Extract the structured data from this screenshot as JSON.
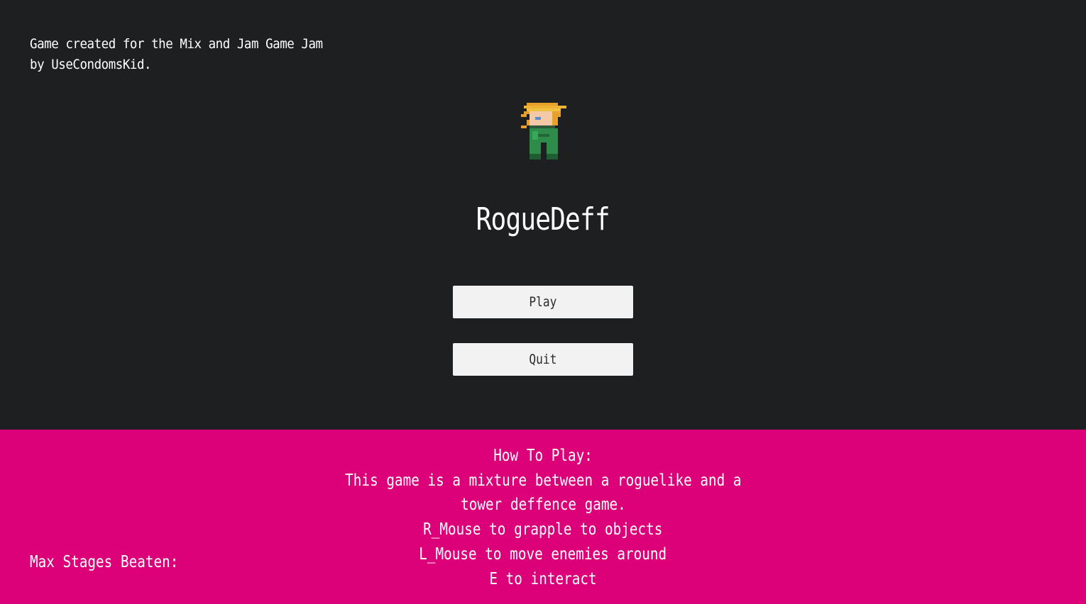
{
  "credits": {
    "line1": "Game created for the Mix and Jam Game Jam",
    "line2": "by UseCondomsKid."
  },
  "title": "RogueDeff",
  "menu": {
    "play_label": "Play",
    "quit_label": "Quit"
  },
  "how_to_play": {
    "heading": "How To Play:",
    "lines": [
      "This game is a mixture between a roguelike and a",
      "tower deffence game.",
      "R_Mouse to grapple to objects",
      "L_Mouse to move enemies around",
      "E to interact"
    ]
  },
  "stats": {
    "max_stages_label": "Max Stages Beaten:"
  },
  "colors": {
    "background": "#1e1f21",
    "panel_accent": "#dc0178",
    "button_bg": "#f2f2f2",
    "text": "#ffffff"
  },
  "icons": {
    "player_sprite": "player-character-icon"
  }
}
